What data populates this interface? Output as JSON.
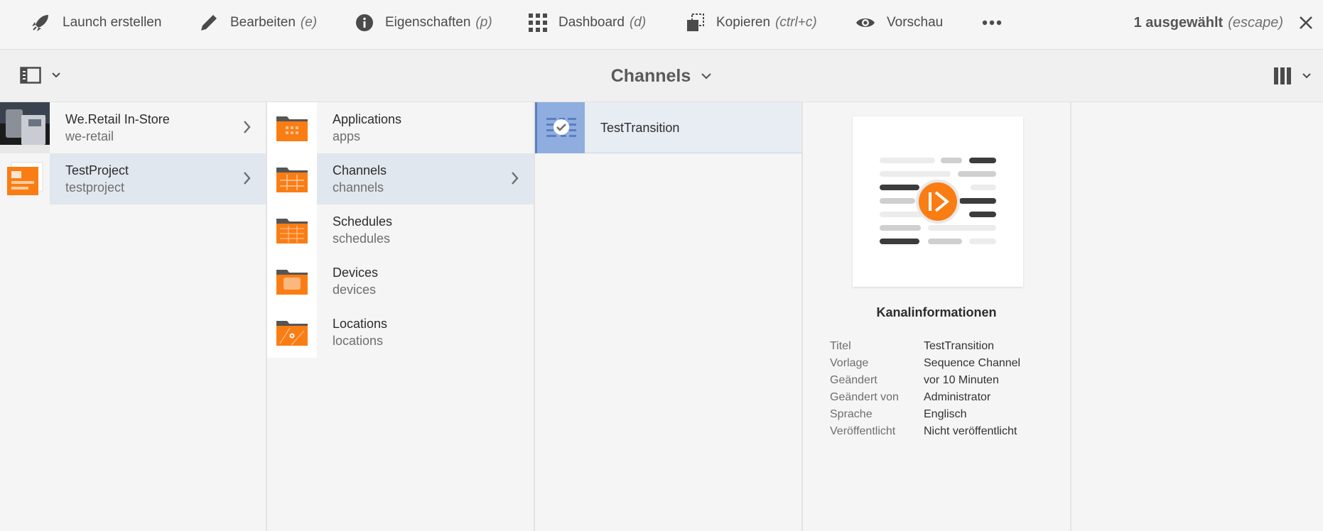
{
  "actionbar": {
    "actions": [
      {
        "label": "Launch erstellen",
        "shortcut": "",
        "icon": "rocket-icon"
      },
      {
        "label": "Bearbeiten",
        "shortcut": "(e)",
        "icon": "pencil-icon"
      },
      {
        "label": "Eigenschaften",
        "shortcut": "(p)",
        "icon": "info-icon"
      },
      {
        "label": "Dashboard",
        "shortcut": "(d)",
        "icon": "grid-icon"
      },
      {
        "label": "Kopieren",
        "shortcut": "(ctrl+c)",
        "icon": "copy-icon"
      },
      {
        "label": "Vorschau",
        "shortcut": "",
        "icon": "eye-icon"
      }
    ],
    "more_icon": "more-icon",
    "selection_label": "1 ausgewählt",
    "selection_shortcut": "(escape)",
    "close_icon": "close-icon"
  },
  "titlebar": {
    "title": "Channels",
    "rail_icon": "rail-toggle-icon",
    "view_icon": "column-view-icon"
  },
  "columns": {
    "col1": [
      {
        "title": "We.Retail In-Store",
        "name": "we-retail"
      },
      {
        "title": "TestProject",
        "name": "testproject"
      }
    ],
    "col2": [
      {
        "title": "Applications",
        "name": "apps"
      },
      {
        "title": "Channels",
        "name": "channels"
      },
      {
        "title": "Schedules",
        "name": "schedules"
      },
      {
        "title": "Devices",
        "name": "devices"
      },
      {
        "title": "Locations",
        "name": "locations"
      }
    ],
    "col3": [
      {
        "title": "TestTransition"
      }
    ]
  },
  "info": {
    "heading": "Kanalinformationen",
    "fields": [
      {
        "key": "Titel",
        "value": "TestTransition"
      },
      {
        "key": "Vorlage",
        "value": "Sequence Channel"
      },
      {
        "key": "Geändert",
        "value": "vor 10 Minuten"
      },
      {
        "key": "Geändert von",
        "value": "Administrator"
      },
      {
        "key": "Sprache",
        "value": "Englisch"
      },
      {
        "key": "Veröffentlicht",
        "value": "Nicht veröffentlicht"
      }
    ]
  },
  "colors": {
    "accent_orange": "#fa7d14",
    "selection_blue": "#8faedf",
    "active_row": "#e1e7ee"
  }
}
